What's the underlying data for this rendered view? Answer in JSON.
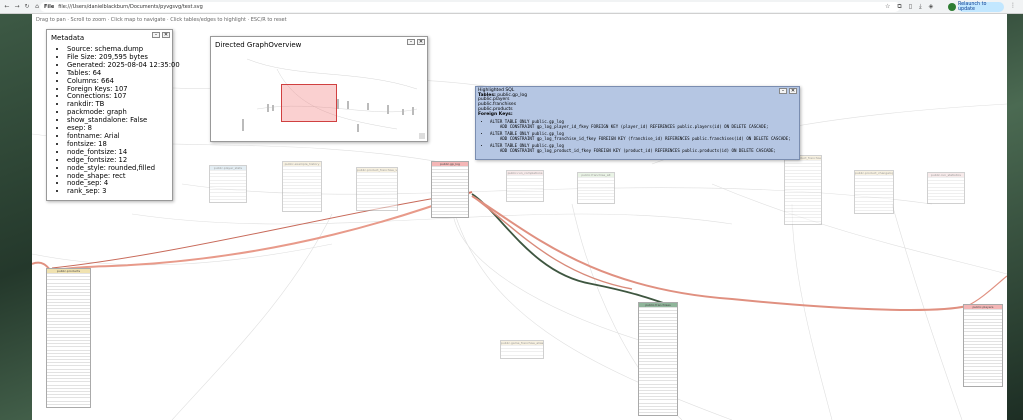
{
  "browser": {
    "back_icon": "arrow-left-icon",
    "url_chip": "File",
    "url": "file:///Users/danielblackburn/Documents/pyvgsvg/test.svg",
    "relaunch_label": "Relaunch to update"
  },
  "hint": "Drag to pan · Scroll to zoom · Click map to navigate · Click tables/edges to highlight · ESC/R to reset",
  "metadata": {
    "title": "Metadata",
    "items": [
      "Source: schema.dump",
      "File Size: 209,595 bytes",
      "Generated: 2025-08-04 12:35:00",
      "Tables: 64",
      "Columns: 664",
      "Foreign Keys: 107",
      "Connections: 107",
      "rankdir: TB",
      "packmode: graph",
      "show_standalone: False",
      "esep: 8",
      "fontname: Arial",
      "fontsize: 18",
      "node_fontsize: 14",
      "edge_fontsize: 12",
      "node_style: rounded,filled",
      "node_shape: rect",
      "node_sep: 4",
      "rank_sep: 3"
    ]
  },
  "overview": {
    "title": "Directed GraphOverview"
  },
  "sql": {
    "heading": "Highlighted SQL",
    "tables_label": "Tables:",
    "tables_first": "public.gp_log",
    "tables_rest": [
      "public.players",
      "public.franchises",
      "public.products"
    ],
    "fk_label": "Foreign Keys:",
    "statements": [
      "ALTER TABLE ONLY public.gp_log\n    ADD CONSTRAINT gp_log_player_id_fkey FOREIGN KEY (player_id) REFERENCES public.players(id) ON DELETE CASCADE;",
      "ALTER TABLE ONLY public.gp_log\n    ADD CONSTRAINT gp_log_franchise_id_fkey FOREIGN KEY (franchise_id) REFERENCES public.franchises(id) ON DELETE CASCADE;",
      "ALTER TABLE ONLY public.gp_log\n    ADD CONSTRAINT gp_log_product_id_fkey FOREIGN KEY (product_id) REFERENCES public.products(id) ON DELETE CASCADE;"
    ]
  },
  "tables": {
    "gp_log": {
      "name": "public.gp_log",
      "color": "#f4b6b6"
    },
    "products": {
      "name": "public.products",
      "color": "#f0e2b0"
    },
    "franchises": {
      "name": "public.franchises",
      "color": "#8fb59a"
    },
    "players": {
      "name": "public.players",
      "color": "#f4b6b6"
    },
    "t1": {
      "name": "public.player_stats",
      "color": "#cde0ea"
    },
    "t2": {
      "name": "public.example_history",
      "color": "#f2e6c9"
    },
    "t3": {
      "name": "public.product_franchise_variant",
      "color": "#f2e6c9"
    },
    "t4": {
      "name": "public.run_completions",
      "color": "#f2d9d9"
    },
    "t5": {
      "name": "public.franchise_alt",
      "color": "#d8ead0"
    },
    "t6": {
      "name": "public.product_franchise_map",
      "color": "#f2e6c9"
    },
    "t7": {
      "name": "public.product_changelog",
      "color": "#f2e6c9"
    },
    "t8": {
      "name": "public.run_statistics",
      "color": "#f2d9d9"
    },
    "t9": {
      "name": "public.game_franchise_alias",
      "color": "#f2e6c9"
    },
    "t10": {
      "name": "public.external_ids",
      "color": "#cde0ea"
    }
  }
}
